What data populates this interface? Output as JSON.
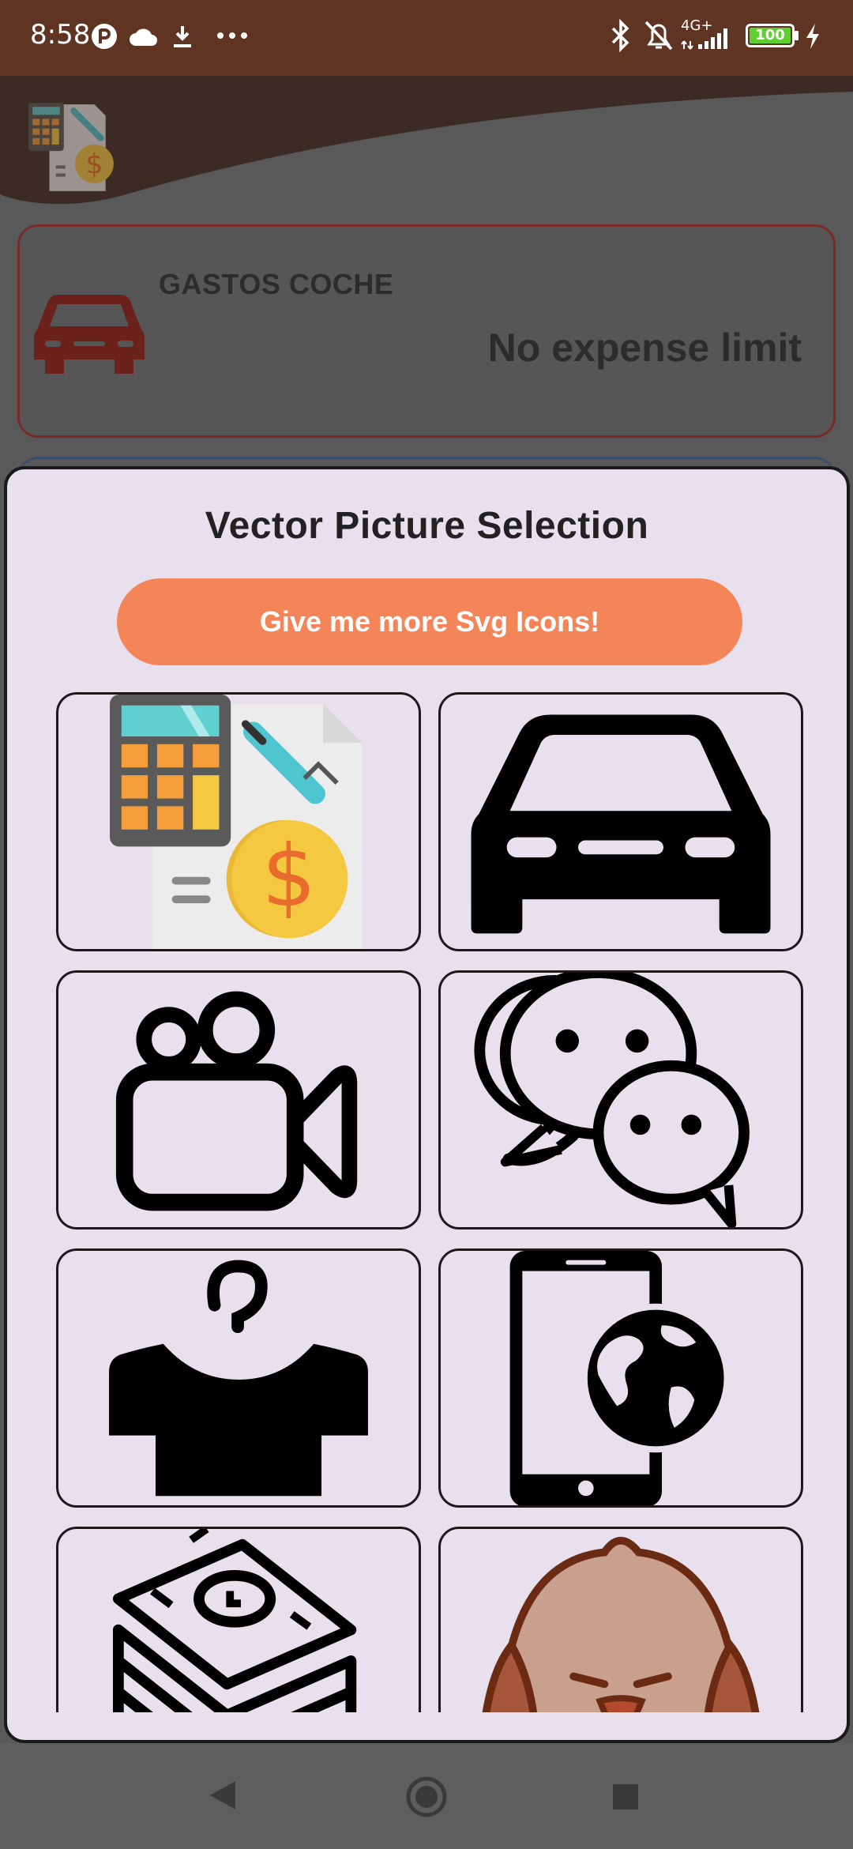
{
  "status_bar": {
    "time": "8:58",
    "network": "4G+",
    "battery": "100",
    "icons": [
      "app-indicator-icon",
      "cloud-icon",
      "download-icon",
      "more-dots-icon",
      "bluetooth-icon",
      "mute-icon",
      "signal-icon",
      "battery-icon",
      "charging-icon"
    ]
  },
  "background": {
    "card": {
      "title": "GASTOS COCHE",
      "limit": "No expense limit",
      "icon": "car-icon",
      "color": "#772b24"
    }
  },
  "dialog": {
    "title": "Vector Picture Selection",
    "more_button": "Give me more Svg Icons!",
    "button_color": "#f48558",
    "icons": [
      "calculator-money-icon",
      "car-icon",
      "video-camera-icon",
      "chat-bubbles-icon",
      "shirt-hanger-icon",
      "phone-globe-icon",
      "money-stack-icon",
      "dog-icon"
    ]
  },
  "nav_bar": {
    "buttons": [
      "back-icon",
      "home-icon",
      "recents-icon"
    ]
  }
}
